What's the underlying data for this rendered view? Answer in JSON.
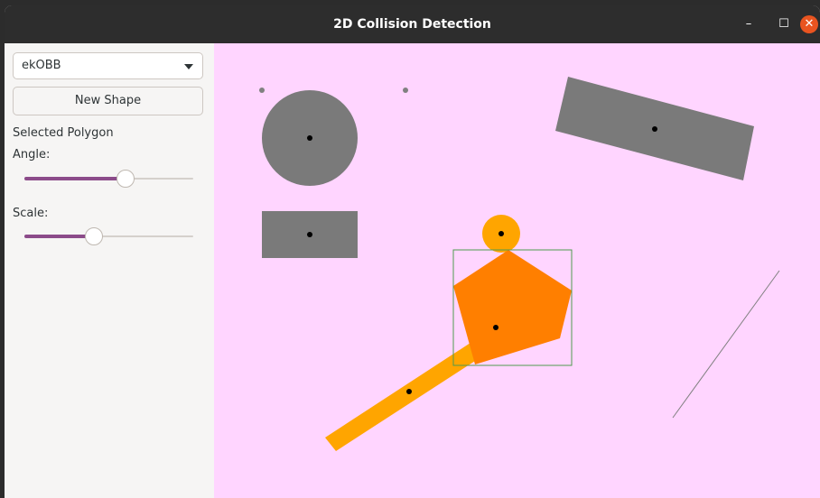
{
  "window": {
    "title": "2D Collision Detection",
    "controls": {
      "minimize": "–",
      "maximize": "☐",
      "close": "✕"
    },
    "close_color": "#e95420"
  },
  "sidebar": {
    "mode_select": {
      "value": "ekOBB"
    },
    "new_shape_label": "New Shape",
    "selected_label": "Selected Polygon",
    "angle_label": "Angle:",
    "angle_value": 0.6,
    "scale_label": "Scale:",
    "scale_value": 0.41,
    "accent": "#8c4b8a"
  },
  "canvas": {
    "background": "#ffd5ff",
    "shape_colors": {
      "idle": "#7a7a7a",
      "colliding": "#ffa500",
      "selected": "#ff7f00",
      "bounding_box": "#4f9a4f",
      "line": "#808080"
    }
  }
}
